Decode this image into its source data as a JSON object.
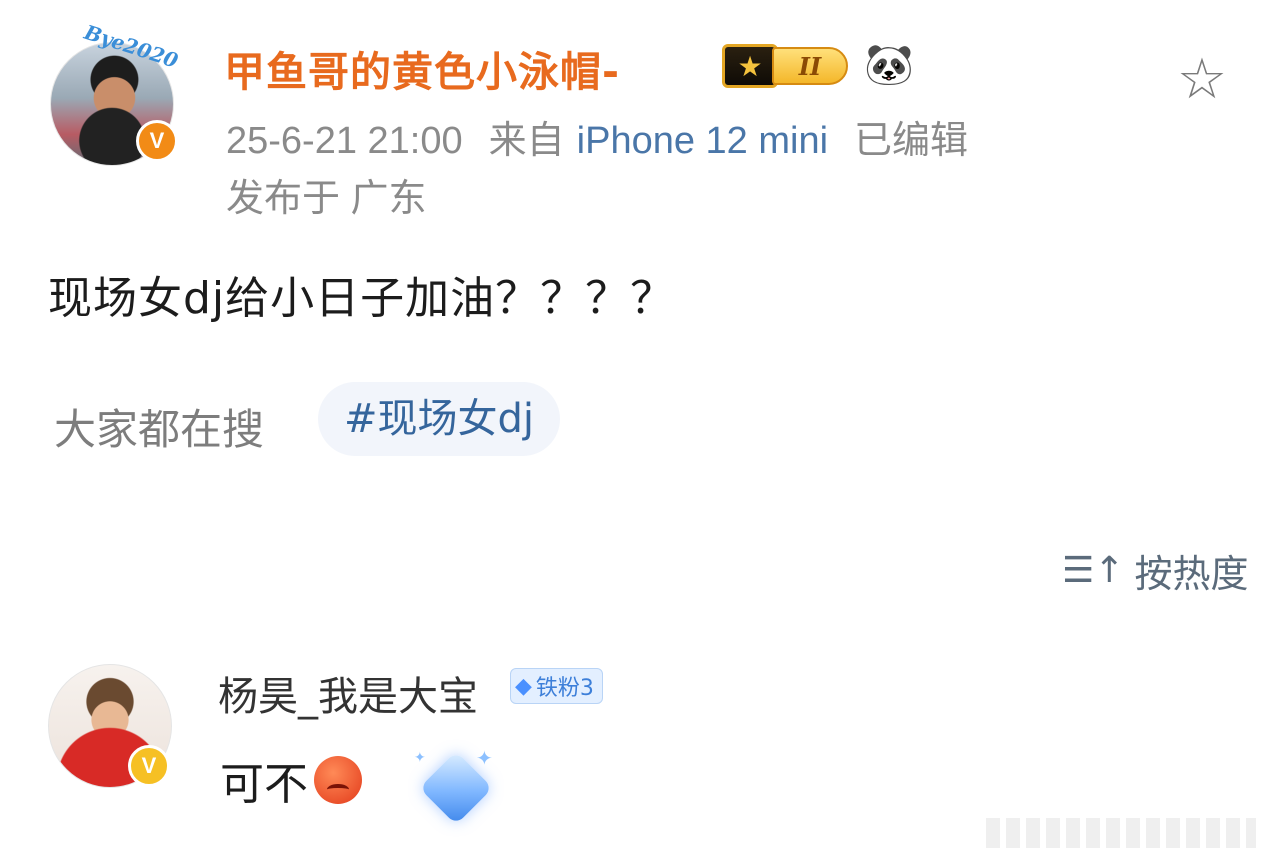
{
  "post": {
    "author": "甲鱼哥的黄色小泳帽-",
    "avatar_deco_text": "Bye2020",
    "verified_mark": "V",
    "vip_level": "II",
    "crown_glyph": "★",
    "panda_glyph": "🐼",
    "star_glyph": "☆",
    "timestamp": "25-6-21 21:00",
    "source_prefix": "来自",
    "device": "iPhone 12 mini",
    "edited": "已编辑",
    "location": "发布于 广东",
    "text": "现场女dj给小日子加油？？？？"
  },
  "search": {
    "label": "大家都在搜",
    "topic": "#现场女dj"
  },
  "sort": {
    "icon": "☰↑",
    "label": "按热度"
  },
  "comment": {
    "author": "杨昊_我是大宝",
    "badge_icon": "◆",
    "badge": "铁粉3",
    "verified_mark": "V",
    "text": "可不",
    "emoji_name": "angry-face-emoji",
    "sparkle_glyph": "✦"
  },
  "colors": {
    "author": "#e86a1e",
    "link": "#4a76a8",
    "topic_bg": "#f2f5fb"
  }
}
